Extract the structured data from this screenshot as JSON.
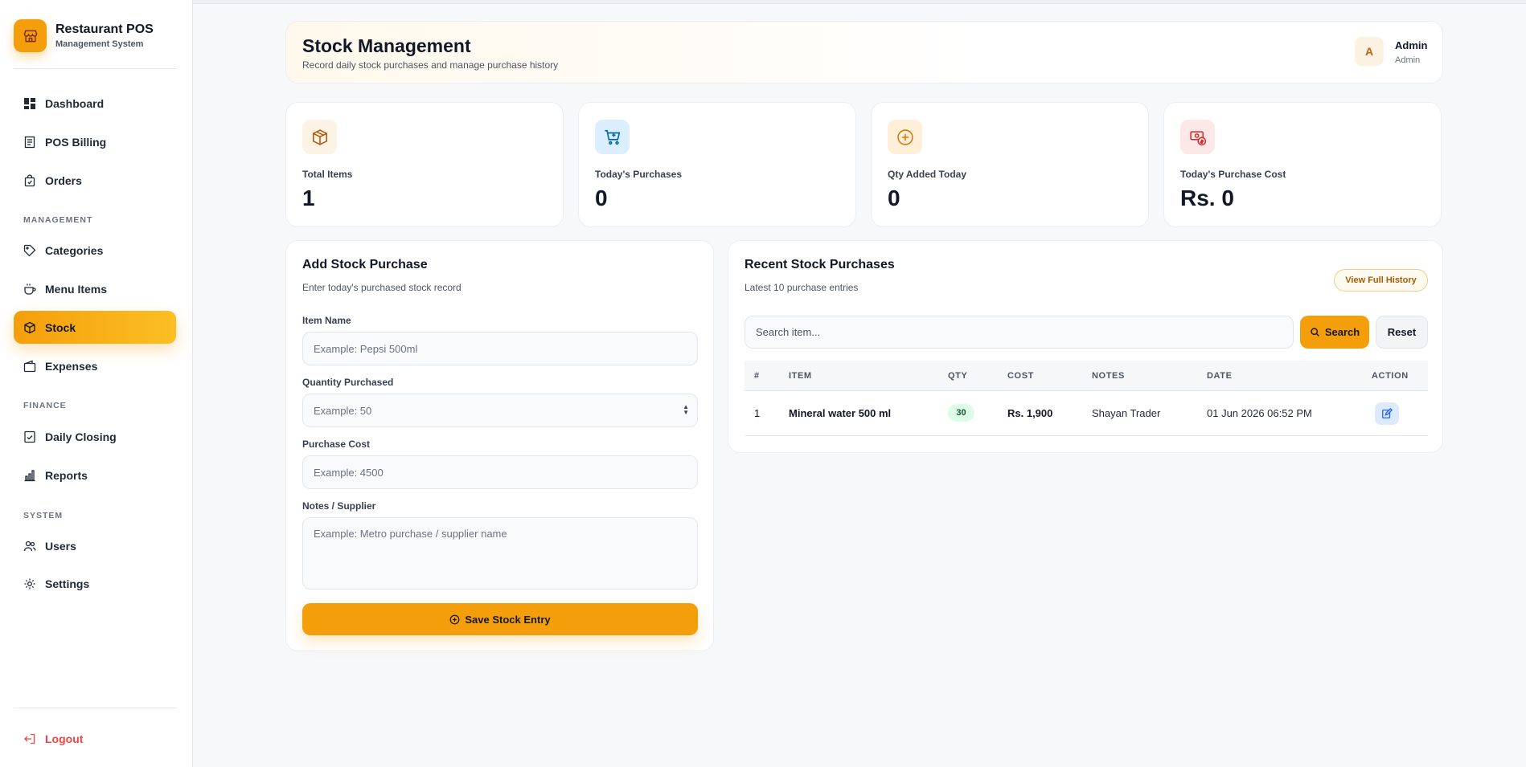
{
  "app": {
    "title": "Restaurant POS",
    "subtitle": "Management System"
  },
  "sidebar": {
    "items": [
      {
        "label": "Dashboard",
        "icon": "dashboard-icon"
      },
      {
        "label": "POS Billing",
        "icon": "receipt-icon"
      },
      {
        "label": "Orders",
        "icon": "shopping-bag-icon"
      }
    ],
    "sections": {
      "management": "MANAGEMENT",
      "finance": "FINANCE",
      "system": "SYSTEM"
    },
    "management_items": [
      {
        "label": "Categories",
        "icon": "tag-icon"
      },
      {
        "label": "Menu Items",
        "icon": "coffee-cup-icon"
      },
      {
        "label": "Stock",
        "icon": "box-icon",
        "active": true
      },
      {
        "label": "Expenses",
        "icon": "wallet-icon"
      }
    ],
    "finance_items": [
      {
        "label": "Daily Closing",
        "icon": "checklist-icon"
      },
      {
        "label": "Reports",
        "icon": "bar-chart-icon"
      }
    ],
    "system_items": [
      {
        "label": "Users",
        "icon": "users-icon"
      },
      {
        "label": "Settings",
        "icon": "gear-icon"
      }
    ],
    "logout": "Logout"
  },
  "header": {
    "title": "Stock Management",
    "subtitle": "Record daily stock purchases and manage purchase history",
    "user": {
      "initial": "A",
      "name": "Admin",
      "role": "Admin"
    }
  },
  "stats": [
    {
      "label": "Total Items",
      "value": "1",
      "icon": "box-icon"
    },
    {
      "label": "Today's Purchases",
      "value": "0",
      "icon": "cart-plus-icon"
    },
    {
      "label": "Qty Added Today",
      "value": "0",
      "icon": "plus-circle-icon"
    },
    {
      "label": "Today's Purchase Cost",
      "value": "Rs. 0",
      "icon": "cash-icon"
    }
  ],
  "form": {
    "title": "Add Stock Purchase",
    "subtitle": "Enter today's purchased stock record",
    "item_label": "Item Name",
    "item_placeholder": "Example: Pepsi 500ml",
    "qty_label": "Quantity Purchased",
    "qty_placeholder": "Example: 50",
    "cost_label": "Purchase Cost",
    "cost_placeholder": "Example: 4500",
    "notes_label": "Notes / Supplier",
    "notes_placeholder": "Example: Metro purchase / supplier name",
    "save_label": "Save Stock Entry"
  },
  "recent": {
    "title": "Recent Stock Purchases",
    "subtitle": "Latest 10 purchase entries",
    "history_label": "View Full History",
    "search_placeholder": "Search item...",
    "search_label": "Search",
    "reset_label": "Reset",
    "columns": [
      "#",
      "ITEM",
      "QTY",
      "COST",
      "NOTES",
      "DATE",
      "ACTION"
    ],
    "rows": [
      {
        "num": "1",
        "item": "Mineral water 500 ml",
        "qty": "30",
        "cost": "Rs. 1,900",
        "notes": "Shayan Trader",
        "date": "01 Jun 2026 06:52 PM"
      }
    ]
  },
  "colors": {
    "accent": "#f59e0b",
    "accent_light": "#fbbf24",
    "danger": "#ef4444",
    "qty_badge_bg": "#dcfce7",
    "edit_bg": "#dbeafe"
  }
}
